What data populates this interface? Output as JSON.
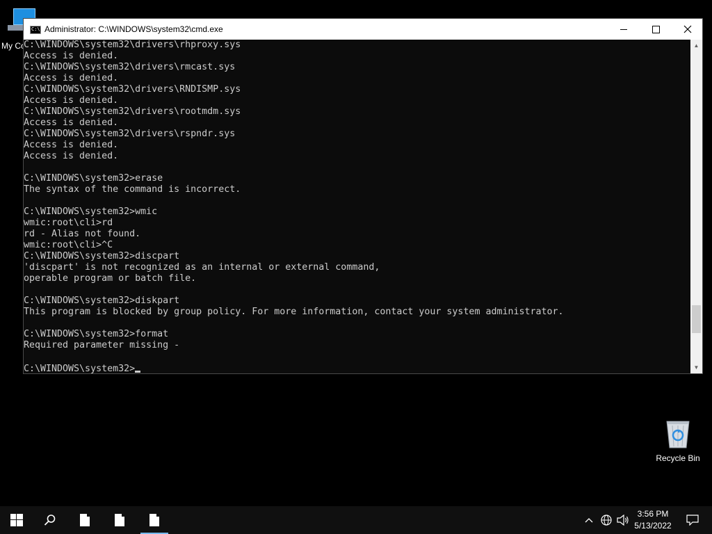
{
  "desktop": {
    "icons": [
      {
        "label": "My Co"
      },
      {
        "label": "Recycle Bin"
      }
    ]
  },
  "window": {
    "title": "Administrator: C:\\WINDOWS\\system32\\cmd.exe",
    "icon_text": "C:\\",
    "console_lines": [
      "C:\\WINDOWS\\system32\\drivers\\rhproxy.sys",
      "Access is denied.",
      "C:\\WINDOWS\\system32\\drivers\\rmcast.sys",
      "Access is denied.",
      "C:\\WINDOWS\\system32\\drivers\\RNDISMP.sys",
      "Access is denied.",
      "C:\\WINDOWS\\system32\\drivers\\rootmdm.sys",
      "Access is denied.",
      "C:\\WINDOWS\\system32\\drivers\\rspndr.sys",
      "Access is denied.",
      "Access is denied.",
      "",
      "C:\\WINDOWS\\system32>erase",
      "The syntax of the command is incorrect.",
      "",
      "C:\\WINDOWS\\system32>wmic",
      "wmic:root\\cli>rd",
      "rd - Alias not found.",
      "wmic:root\\cli>^C",
      "C:\\WINDOWS\\system32>discpart",
      "'discpart' is not recognized as an internal or external command,",
      "operable program or batch file.",
      "",
      "C:\\WINDOWS\\system32>diskpart",
      "This program is blocked by group policy. For more information, contact your system administrator.",
      "",
      "C:\\WINDOWS\\system32>format",
      "Required parameter missing -",
      ""
    ],
    "prompt": "C:\\WINDOWS\\system32>",
    "scroll_position": 0.9
  },
  "taskbar": {
    "time": "3:56 PM",
    "date": "5/13/2022"
  },
  "colors": {
    "console_bg": "#0c0c0c",
    "console_text": "#cccccc",
    "taskbar_bg": "#101010",
    "active_indicator": "#76b9ed"
  }
}
